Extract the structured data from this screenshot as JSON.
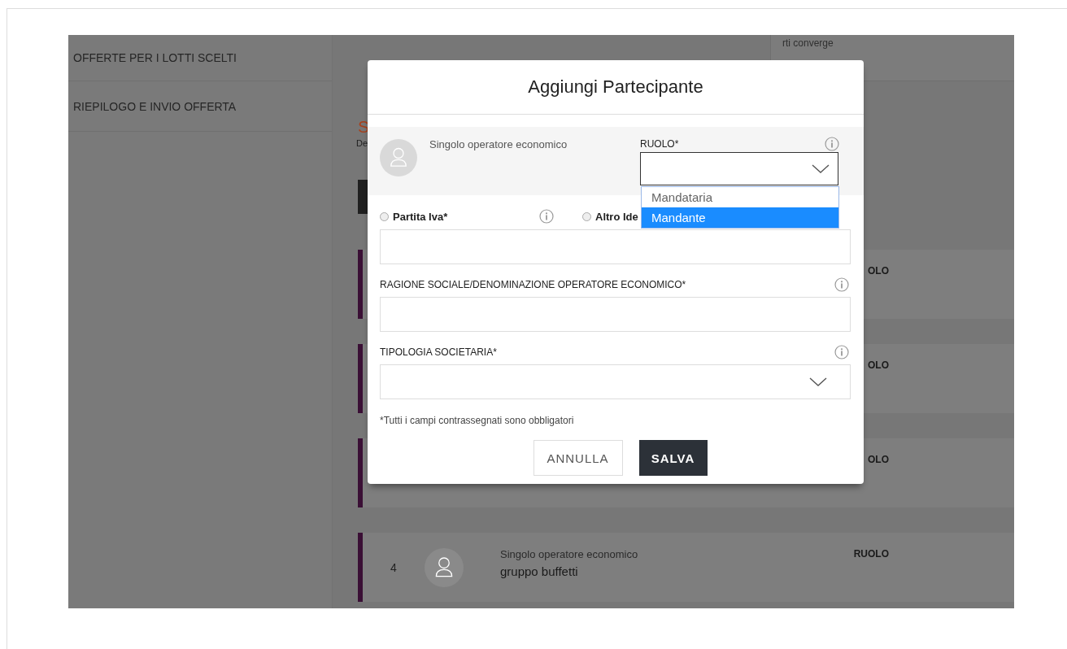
{
  "sidebar": {
    "items": [
      {
        "label": "OFFERTE PER I LOTTI SCELTI"
      },
      {
        "label": "RIEPILOGO E INVIO OFFERTA"
      }
    ]
  },
  "main": {
    "top_right_text": "rti converge",
    "heading_fragment": "S",
    "subheading_fragment": "De",
    "rows": [
      {
        "role": "OLO"
      },
      {
        "role": "OLO"
      },
      {
        "role": "OLO"
      },
      {
        "number": "4",
        "type": "Singolo operatore economico",
        "name": "gruppo buffetti",
        "role": "RUOLO"
      }
    ]
  },
  "modal": {
    "title": "Aggiungi Partecipante",
    "participant": {
      "type": "Singolo operatore economico",
      "role_label": "RUOLO*",
      "role_options": [
        {
          "label": "Mandataria",
          "selected": false
        },
        {
          "label": "Mandante",
          "selected": true
        }
      ]
    },
    "id_options": [
      {
        "label": "Partita Iva*",
        "selected": false
      },
      {
        "label": "Altro Ide",
        "selected": false
      }
    ],
    "fields": [
      {
        "kind": "input",
        "label": "RAGIONE SOCIALE/DENOMINAZIONE OPERATORE ECONOMICO*"
      },
      {
        "kind": "select",
        "label": "TIPOLOGIA SOCIETARIA*"
      }
    ],
    "note": "*Tutti i campi contrassegnati sono obbligatori",
    "buttons": [
      {
        "label": "ANNULLA",
        "kind": "secondary"
      },
      {
        "label": "SALVA",
        "kind": "primary"
      }
    ]
  }
}
